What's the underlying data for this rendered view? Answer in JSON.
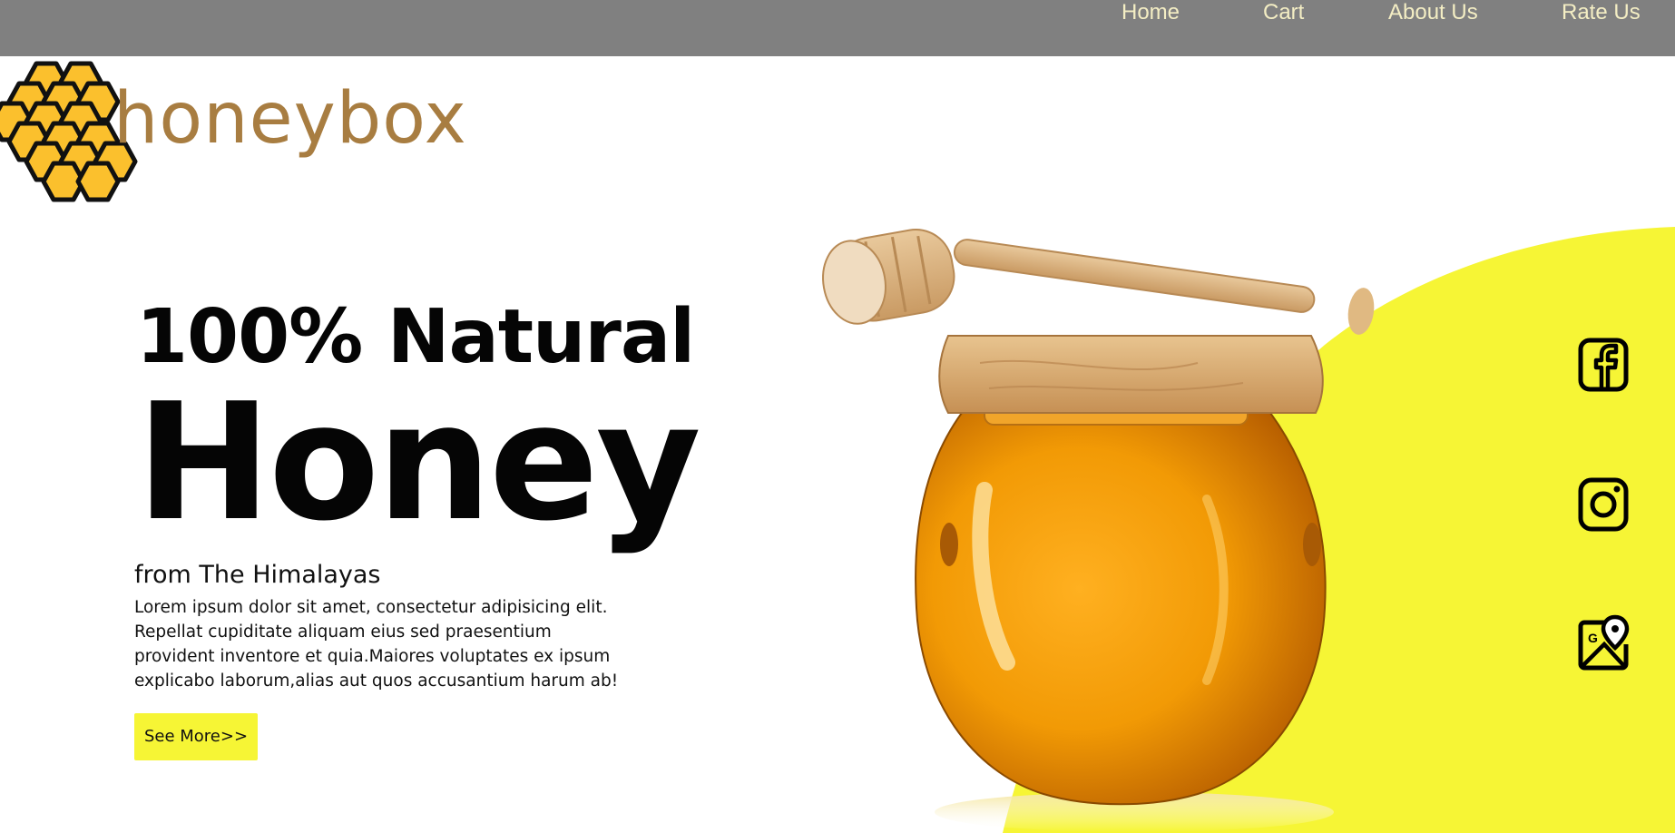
{
  "nav": {
    "items": [
      {
        "label": "Home"
      },
      {
        "label": "Cart"
      },
      {
        "label": "About Us"
      },
      {
        "label": "Rate Us"
      }
    ]
  },
  "brand": {
    "name": "honeybox",
    "logo_icon": "honeycomb-icon",
    "color": "#a87d41"
  },
  "hero": {
    "headline_top": "100% Natural",
    "headline_main": "Honey",
    "subtitle": "from The Himalayas",
    "description": "Lorem ipsum dolor sit amet, consectetur adipisicing elit. Repellat cupiditate aliquam eius sed praesentium provident inventore et quia.Maiores voluptates ex ipsum explicabo laborum,alias aut quos accusantium harum ab!",
    "cta_label": "See More>>",
    "image": "honey-jar-with-dipper"
  },
  "social": [
    {
      "icon": "facebook-icon"
    },
    {
      "icon": "instagram-icon"
    },
    {
      "icon": "google-maps-icon"
    }
  ],
  "colors": {
    "navbar": "#808080",
    "nav_text": "#f4eec4",
    "accent_yellow": "#f6f535",
    "honey": "#f0a010"
  }
}
